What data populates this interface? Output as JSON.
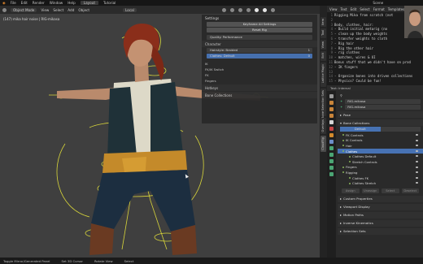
{
  "topbar": {
    "menus": [
      "File",
      "Edit",
      "Render",
      "Window",
      "Help"
    ],
    "workspaces": [
      "Layout",
      "Tutorial"
    ],
    "active_workspace": "Layout",
    "scene_label": "Scene"
  },
  "viewport": {
    "header": {
      "mode": "Object Mode",
      "menus": [
        "View",
        "Select",
        "Add",
        "Object"
      ],
      "orientation": "Local"
    },
    "info_lines": [
      "(147) mika hair noise | RIG-mikasa",
      ""
    ]
  },
  "n_panel": {
    "title": "Settings",
    "buttons": [
      "Keyframe All Settings",
      "Reset Rig"
    ],
    "quality_label": "Quality: Performance",
    "character_section": "Character",
    "character_rows": [
      {
        "label": "Hairstyle: Braided",
        "value": "1",
        "selected": false
      },
      {
        "label": "Clothes: Default",
        "value": "0",
        "selected": true
      }
    ],
    "sub_sections": [
      "IK",
      "FK/IK Switch",
      "FK",
      "Fingers",
      "Hotkeys",
      "Bone Collections"
    ]
  },
  "side_tabs": [
    "Item",
    "Tool",
    "View",
    "Edit",
    "Lattice Magic",
    "Bone Selection Sets",
    "Overlays",
    "CloudRig"
  ],
  "text_editor": {
    "menus": [
      "View",
      "Text",
      "Edit",
      "Select",
      "Format",
      "Templates"
    ],
    "lines": [
      "Rigging Mika from scratch (not",
      "",
      "Body, clothes, hair:",
      "- Build initial metarig (no",
      "- clean up the body weights",
      "- transfer weights to cloth",
      "- Rig hair",
      "- Rig the other hair",
      "- rig clothes",
      "- matches, wires & UI",
      "Bonus stuff that we didn't have on prod",
      "- IK fingers",
      "",
      "- Organize bones into driven collections",
      "- Physics? Could be fun!"
    ],
    "footer": "Text: Internal"
  },
  "properties": {
    "object_name": "RIG-mikasa",
    "data_name": "RIG-mikasa",
    "data_field": "RIG-mikasa",
    "sections": {
      "pose": "Pose",
      "bone_collections": "Bone Collections",
      "custom_properties": "Custom Properties",
      "viewport_display": "Viewport Display",
      "motion_paths": "Motion Paths",
      "inverse_kinematics": "Inverse Kinematics",
      "selection_sets": "Selection Sets"
    },
    "collection_tabs": [
      "Default",
      ""
    ],
    "collections": [
      {
        "label": "FK Controls",
        "indent": false,
        "selected": false
      },
      {
        "label": "IK Controls",
        "indent": false,
        "selected": false
      },
      {
        "label": "Hair",
        "indent": false,
        "selected": false
      },
      {
        "label": "Clothes",
        "indent": false,
        "selected": true
      },
      {
        "label": "Clothes Default",
        "indent": true,
        "selected": false
      },
      {
        "label": "Stretch Controls",
        "indent": true,
        "selected": false
      },
      {
        "label": "Fingers",
        "indent": false,
        "selected": false
      },
      {
        "label": "Rigging",
        "indent": false,
        "selected": false
      },
      {
        "label": "Clothes FK",
        "indent": true,
        "selected": false
      },
      {
        "label": "Clothes Stretch",
        "indent": true,
        "selected": false
      }
    ],
    "collection_buttons": [
      "Assign",
      "Unassign",
      "Select",
      "Deselect"
    ]
  },
  "statusbar": {
    "items": [
      "Toggle Mirror/Generated Panel",
      "Set 3D Cursor",
      "Rotate View",
      "Select"
    ]
  },
  "colors": {
    "selection_blue": "#4772b3",
    "rig_yellow": "#e8e53a",
    "hair_red": "#8a2e1a"
  }
}
